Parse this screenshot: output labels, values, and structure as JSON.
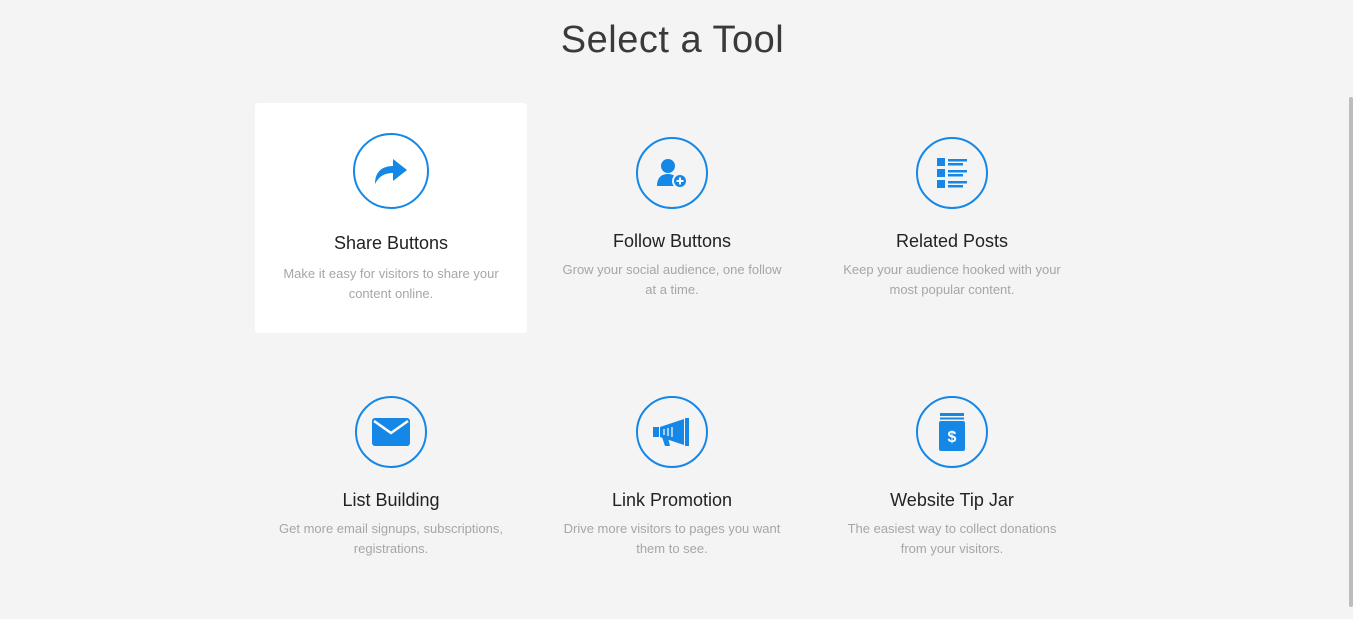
{
  "header": {
    "title": "Select a Tool"
  },
  "colors": {
    "accent": "#1587e6",
    "background": "#f4f4f4",
    "card_selected": "#ffffff"
  },
  "tools": [
    {
      "name": "Share Buttons",
      "description": "Make it easy for visitors to share your content online.",
      "icon": "share-arrow-icon",
      "selected": true
    },
    {
      "name": "Follow Buttons",
      "description": "Grow your social audience, one follow at a time.",
      "icon": "follow-user-icon",
      "selected": false
    },
    {
      "name": "Related Posts",
      "description": "Keep your audience hooked with your most popular content.",
      "icon": "list-icon",
      "selected": false
    },
    {
      "name": "List Building",
      "description": "Get more email signups, subscriptions, registrations.",
      "icon": "envelope-icon",
      "selected": false
    },
    {
      "name": "Link Promotion",
      "description": "Drive more visitors to pages you want them to see.",
      "icon": "megaphone-icon",
      "selected": false
    },
    {
      "name": "Website Tip Jar",
      "description": "The easiest way to collect donations from your visitors.",
      "icon": "tip-jar-icon",
      "selected": false
    }
  ]
}
